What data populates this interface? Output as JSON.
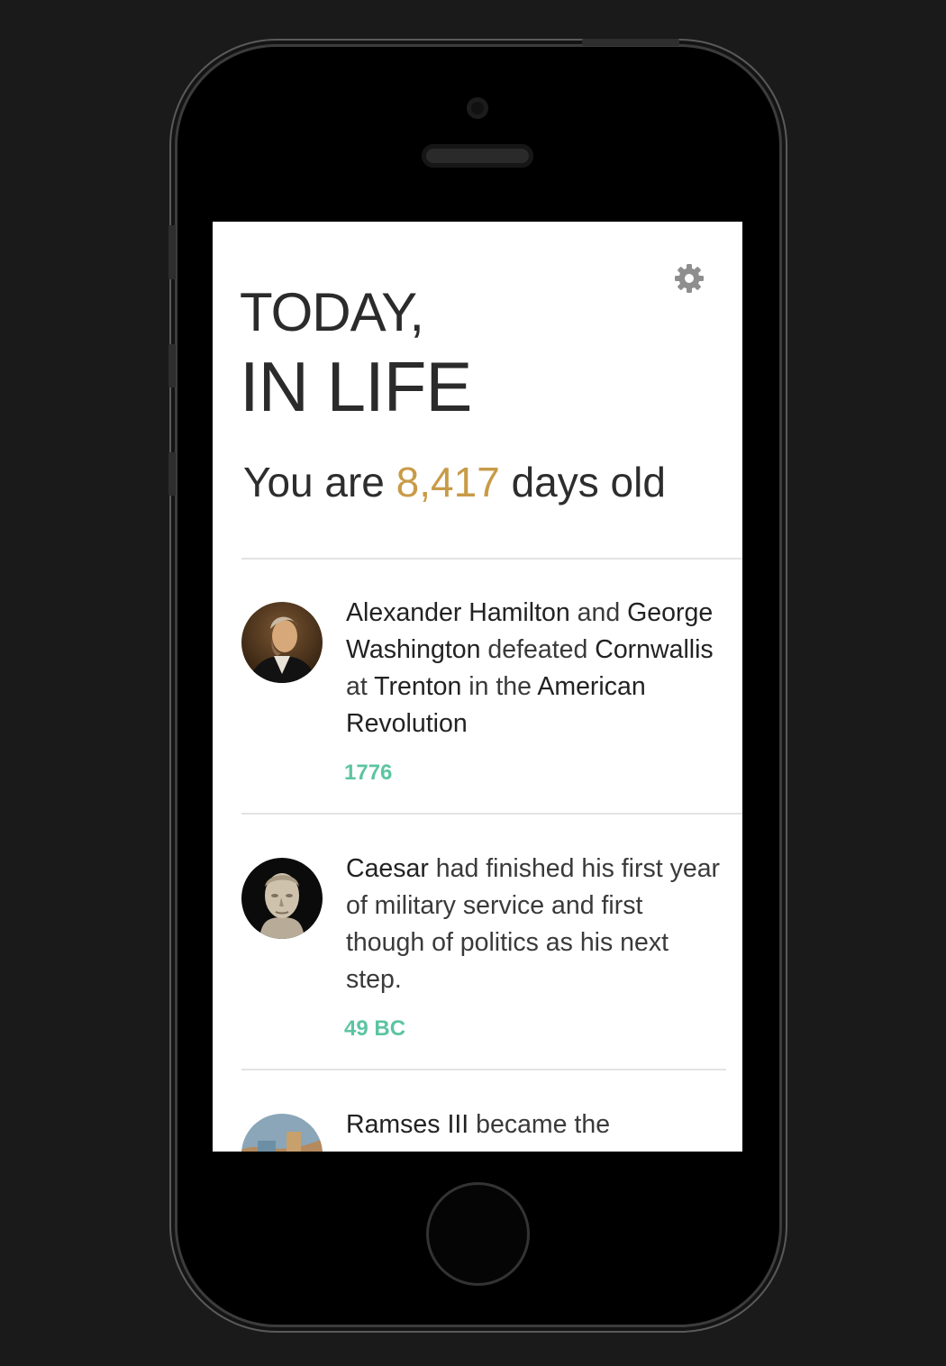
{
  "app": {
    "title_line1": "TODAY,",
    "title_line2": "IN LIFE",
    "settings_icon": "gear-icon"
  },
  "age": {
    "prefix": "You are",
    "days": "8,417",
    "suffix": "days old"
  },
  "events": [
    {
      "avatar": "hamilton-portrait",
      "parts": [
        {
          "text": "Alexander Hamilton",
          "bold": true
        },
        {
          "text": " and ",
          "bold": false
        },
        {
          "text": "George Washington",
          "bold": true
        },
        {
          "text": " defeated ",
          "bold": false
        },
        {
          "text": "Cornwallis",
          "bold": true
        },
        {
          "text": " at ",
          "bold": false
        },
        {
          "text": "Trenton",
          "bold": true
        },
        {
          "text": " in the ",
          "bold": false
        },
        {
          "text": "American Revolution",
          "bold": true
        }
      ],
      "year": "1776"
    },
    {
      "avatar": "caesar-bust",
      "parts": [
        {
          "text": "Caesar",
          "bold": true
        },
        {
          "text": " had finished his first year of military service and first though of politics as his next step.",
          "bold": false
        }
      ],
      "year": "49 BC"
    },
    {
      "avatar": "ramses-relief",
      "parts": [
        {
          "text": "Ramses III",
          "bold": true
        },
        {
          "text": " became the",
          "bold": false
        }
      ],
      "year": ""
    }
  ],
  "colors": {
    "accent_days": "#c89b48",
    "accent_year": "#5cc4a3",
    "background": "#1a1a1a"
  }
}
